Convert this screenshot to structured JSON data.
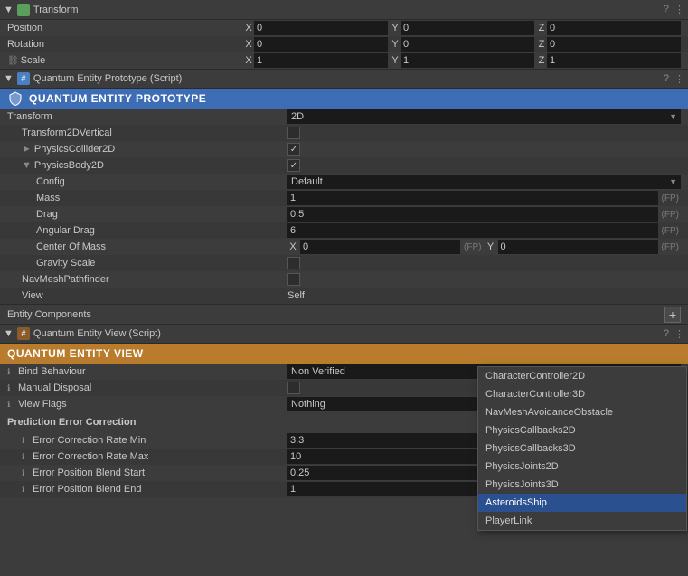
{
  "transform": {
    "header_title": "Transform",
    "position_label": "Position",
    "rotation_label": "Rotation",
    "scale_label": "Scale",
    "position": {
      "x": "0",
      "y": "0",
      "z": "0"
    },
    "rotation": {
      "x": "0",
      "y": "0",
      "z": "0"
    },
    "scale": {
      "x": "1",
      "y": "1",
      "z": "1"
    }
  },
  "quantum_entity_prototype": {
    "script_title": "Quantum Entity Prototype (Script)",
    "header_title": "QUANTUM ENTITY PROTOTYPE",
    "transform_label": "Transform",
    "transform_value": "2D",
    "transform2d_vertical_label": "Transform2DVertical",
    "physics_collider_label": "PhysicsCollider2D",
    "physics_body_label": "PhysicsBody2D",
    "config_label": "Config",
    "config_value": "Default",
    "mass_label": "Mass",
    "mass_value": "1",
    "drag_label": "Drag",
    "drag_value": "0.5",
    "angular_drag_label": "Angular Drag",
    "angular_drag_value": "6",
    "center_of_mass_label": "Center Of Mass",
    "com_x": "0",
    "com_y": "0",
    "gravity_scale_label": "Gravity Scale",
    "navmesh_label": "NavMeshPathfinder",
    "view_label": "View",
    "view_value": "Self",
    "entity_components_label": "Entity Components"
  },
  "quantum_entity_view": {
    "script_title": "Quantum Entity View (Script)",
    "header_title": "QUANTUM ENTITY VIEW",
    "bind_behaviour_label": "Bind Behaviour",
    "bind_behaviour_value": "Non Verified",
    "manual_disposal_label": "Manual Disposal",
    "view_flags_label": "View Flags",
    "view_flags_value": "Nothing",
    "prediction_error_label": "Prediction Error Correction",
    "error_rate_min_label": "Error Correction Rate Min",
    "error_rate_min_value": "3.3",
    "error_rate_max_label": "Error Correction Rate Max",
    "error_rate_max_value": "10",
    "error_position_blend_start_label": "Error Position Blend Start",
    "error_position_blend_start_value": "0.25",
    "error_position_blend_end_label": "Error Position Blend End",
    "error_position_blend_end_value": "1"
  },
  "dropdown_menu": {
    "items": [
      {
        "label": "CharacterController2D",
        "selected": false
      },
      {
        "label": "CharacterController3D",
        "selected": false
      },
      {
        "label": "NavMeshAvoidanceObstacle",
        "selected": false
      },
      {
        "label": "PhysicsCallbacks2D",
        "selected": false
      },
      {
        "label": "PhysicsCallbacks3D",
        "selected": false
      },
      {
        "label": "PhysicsJoints2D",
        "selected": false
      },
      {
        "label": "PhysicsJoints3D",
        "selected": false
      },
      {
        "label": "AsteroidsShip",
        "selected": true
      },
      {
        "label": "PlayerLink",
        "selected": false
      }
    ]
  },
  "icons": {
    "collapse_open": "▼",
    "collapse_closed": "►",
    "question_mark": "?",
    "three_dots": "⋮",
    "gear": "⚙",
    "plus": "+",
    "link": "🔗",
    "shield": "🛡",
    "info": "ℹ"
  }
}
